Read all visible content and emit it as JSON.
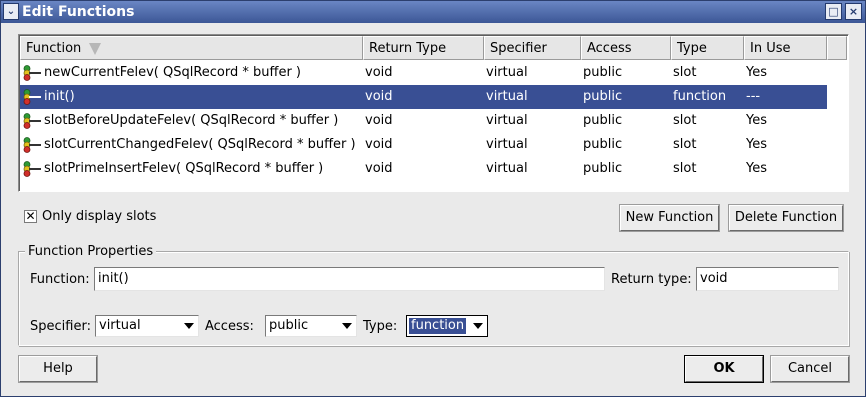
{
  "window": {
    "title": "Edit Functions",
    "menu_glyph": "⌄",
    "minimize_glyph": "□",
    "close_glyph": "×"
  },
  "list": {
    "columns": [
      "Function",
      "Return Type",
      "Specifier",
      "Access",
      "Type",
      "In Use"
    ],
    "rows": [
      {
        "function": "newCurrentFelev( QSqlRecord * buffer )",
        "return_type": "void",
        "specifier": "virtual",
        "access": "public",
        "type": "slot",
        "in_use": "Yes",
        "selected": false
      },
      {
        "function": "init()",
        "return_type": "void",
        "specifier": "virtual",
        "access": "public",
        "type": "function",
        "in_use": "---",
        "selected": true
      },
      {
        "function": "slotBeforeUpdateFelev( QSqlRecord * buffer )",
        "return_type": "void",
        "specifier": "virtual",
        "access": "public",
        "type": "slot",
        "in_use": "Yes",
        "selected": false
      },
      {
        "function": "slotCurrentChangedFelev( QSqlRecord * buffer )",
        "return_type": "void",
        "specifier": "virtual",
        "access": "public",
        "type": "slot",
        "in_use": "Yes",
        "selected": false
      },
      {
        "function": "slotPrimeInsertFelev( QSqlRecord * buffer )",
        "return_type": "void",
        "specifier": "virtual",
        "access": "public",
        "type": "slot",
        "in_use": "Yes",
        "selected": false
      }
    ]
  },
  "options": {
    "only_slots_label": "Only display slots",
    "only_slots_checked": true,
    "check_glyph": "✕"
  },
  "buttons": {
    "new_function": "New Function",
    "delete_function": "Delete Function",
    "help": "Help",
    "ok": "OK",
    "cancel": "Cancel"
  },
  "properties": {
    "group_title": "Function Properties",
    "function_label": "Function:",
    "function_value": "init()",
    "return_type_label": "Return type:",
    "return_type_value": "void",
    "specifier_label": "Specifier:",
    "specifier_value": "virtual",
    "access_label": "Access:",
    "access_value": "public",
    "type_label": "Type:",
    "type_value": "function"
  },
  "colors": {
    "selection": "#394f94",
    "titlebar": "#4a66a8"
  }
}
